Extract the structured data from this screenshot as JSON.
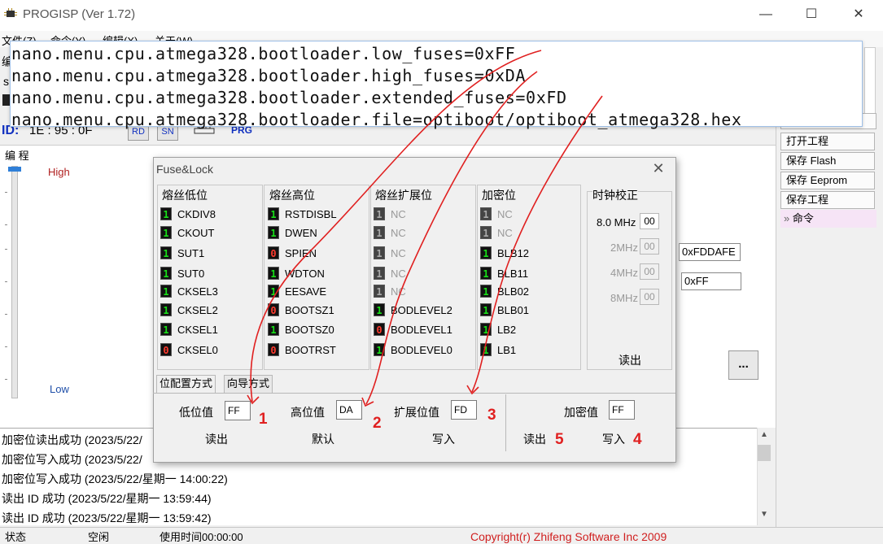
{
  "window": {
    "title": "PROGISP (Ver 1.72)",
    "minimize": "—",
    "maximize": "☐",
    "close": "✕",
    "icon": "chip-icon"
  },
  "menubar": [
    "文件(Z)",
    "命令(Y)",
    "编辑(X)",
    "关于(W)"
  ],
  "left_strip": [
    "编",
    "s"
  ],
  "device": {
    "id_label": "ID:",
    "id_value": "1E : 95 : 0F",
    "rd_button": "RD",
    "sn_button": "SN",
    "prg_label": "PRG"
  },
  "program_panel": {
    "title": "编 程",
    "high_label": "High",
    "low_label": "Low",
    "dots_button": "..."
  },
  "right_panel": {
    "buttons": [
      "打开工程",
      "保存 Flash",
      "保存 Eeprom",
      "保存工程"
    ],
    "command_label": "命令",
    "command_icon": "»"
  },
  "code_overlay": {
    "lines": [
      "nano.menu.cpu.atmega328.bootloader.low_fuses=0xFF",
      "nano.menu.cpu.atmega328.bootloader.high_fuses=0xDA",
      "nano.menu.cpu.atmega328.bootloader.extended_fuses=0xFD",
      "nano.menu.cpu.atmega328.bootloader.file=optiboot/optiboot_atmega328.hex"
    ]
  },
  "dialog": {
    "title": "Fuse&Lock",
    "close": "✕",
    "groups": [
      {
        "title": "熔丝低位",
        "bits": [
          {
            "value": "1",
            "name": "CKDIV8"
          },
          {
            "value": "1",
            "name": "CKOUT"
          },
          {
            "value": "1",
            "name": "SUT1"
          },
          {
            "value": "1",
            "name": "SUT0"
          },
          {
            "value": "1",
            "name": "CKSEL3"
          },
          {
            "value": "1",
            "name": "CKSEL2"
          },
          {
            "value": "1",
            "name": "CKSEL1"
          },
          {
            "value": "0",
            "name": "CKSEL0"
          }
        ]
      },
      {
        "title": "熔丝高位",
        "bits": [
          {
            "value": "1",
            "name": "RSTDISBL"
          },
          {
            "value": "1",
            "name": "DWEN"
          },
          {
            "value": "0",
            "name": "SPIEN"
          },
          {
            "value": "1",
            "name": "WDTON"
          },
          {
            "value": "1",
            "name": "EESAVE"
          },
          {
            "value": "0",
            "name": "BOOTSZ1"
          },
          {
            "value": "1",
            "name": "BOOTSZ0"
          },
          {
            "value": "0",
            "name": "BOOTRST"
          }
        ]
      },
      {
        "title": "熔丝扩展位",
        "bits": [
          {
            "value": "1",
            "name": "NC",
            "disabled": true
          },
          {
            "value": "1",
            "name": "NC",
            "disabled": true
          },
          {
            "value": "1",
            "name": "NC",
            "disabled": true
          },
          {
            "value": "1",
            "name": "NC",
            "disabled": true
          },
          {
            "value": "1",
            "name": "NC",
            "disabled": true
          },
          {
            "value": "1",
            "name": "BODLEVEL2"
          },
          {
            "value": "0",
            "name": "BODLEVEL1"
          },
          {
            "value": "1",
            "name": "BODLEVEL0"
          }
        ]
      },
      {
        "title": "加密位",
        "bits": [
          {
            "value": "1",
            "name": "NC",
            "disabled": true
          },
          {
            "value": "1",
            "name": "NC",
            "disabled": true
          },
          {
            "value": "1",
            "name": "BLB12"
          },
          {
            "value": "1",
            "name": "BLB11"
          },
          {
            "value": "1",
            "name": "BLB02"
          },
          {
            "value": "1",
            "name": "BLB01"
          },
          {
            "value": "1",
            "name": "LB2"
          },
          {
            "value": "1",
            "name": "LB1"
          }
        ]
      }
    ],
    "clock": {
      "title": "时钟校正",
      "rows": [
        {
          "label": "8.0 MHz",
          "value": "00",
          "disabled": false
        },
        {
          "label": "2MHz",
          "value": "00",
          "disabled": true
        },
        {
          "label": "4MHz",
          "value": "00",
          "disabled": true
        },
        {
          "label": "8MHz",
          "value": "00",
          "disabled": true
        }
      ],
      "read_button": "读出"
    },
    "side_fields": [
      "0xFDDAFE",
      "0xFF"
    ],
    "tabs": [
      "位配置方式",
      "向导方式"
    ],
    "fuses": {
      "low_label": "低位值",
      "low_value": "FF",
      "high_label": "高位值",
      "high_value": "DA",
      "ext_label": "扩展位值",
      "ext_value": "FD",
      "lock_label": "加密值",
      "lock_value": "FF"
    },
    "actions": {
      "read": "读出",
      "default": "默认",
      "write": "写入",
      "lock_read": "读出",
      "lock_write": "写入"
    },
    "annotations": [
      "1",
      "2",
      "3",
      "4",
      "5"
    ]
  },
  "log": [
    "加密位读出成功 (2023/5/22/",
    "加密位写入成功 (2023/5/22/",
    "加密位写入成功 (2023/5/22/星期一 14:00:22)",
    "读出 ID 成功 (2023/5/22/星期一 13:59:44)",
    "读出 ID 成功 (2023/5/22/星期一 13:59:42)"
  ],
  "status": {
    "state_label": "状态",
    "state_value": "空闲",
    "time": "使用时间00:00:00",
    "copyright": "Copyright(r) Zhifeng Software Inc 2009"
  },
  "colors": {
    "bit_on": "#18e018",
    "bit_zero": "#ff3b2f",
    "annotation": "#e02020",
    "id_blue": "#1030c0"
  }
}
